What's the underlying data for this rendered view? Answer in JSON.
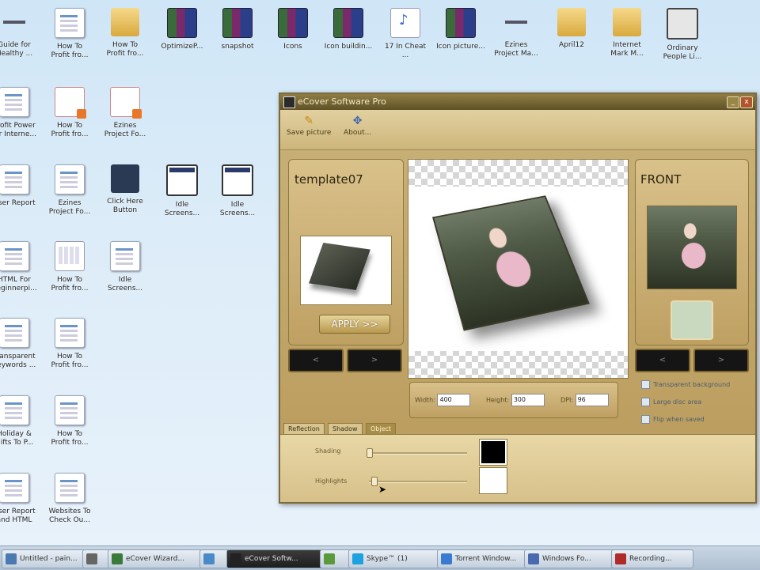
{
  "desktop": {
    "icons": [
      {
        "label": "Guide for\nHealthy ...",
        "glyph": "link-icon"
      },
      {
        "label": "How To\nProfit fro...",
        "glyph": "document-icon"
      },
      {
        "label": "How To\nProfit fro...",
        "glyph": "folder-icon"
      },
      {
        "label": "OptimizeP...",
        "glyph": "archive-icon"
      },
      {
        "label": "snapshot",
        "glyph": "archive-icon"
      },
      {
        "label": "Icons",
        "glyph": "archive-icon"
      },
      {
        "label": "Icon buildin...",
        "glyph": "archive-icon"
      },
      {
        "label": "17 In Cheat\n...",
        "glyph": "audio-file-icon"
      },
      {
        "label": "Icon picture...",
        "glyph": "archive-icon"
      },
      {
        "label": "Ezines\nProject Ma...",
        "glyph": "link-icon"
      },
      {
        "label": "April12",
        "glyph": "folder-icon"
      },
      {
        "label": "Internet\nMark M...",
        "glyph": "folder-icon"
      },
      {
        "label": "Ordinary\nPeople Li...",
        "glyph": "window-icon"
      },
      {
        "label": "Profit Power\nfor Interne...",
        "glyph": "document-icon"
      },
      {
        "label": "How To\nProfit fro...",
        "glyph": "pdf-icon"
      },
      {
        "label": "Ezines\nProject Fo...",
        "glyph": "pdf-icon"
      },
      {
        "label": "User Report",
        "glyph": "document-icon"
      },
      {
        "label": "Ezines\nProject Fo...",
        "glyph": "document-icon"
      },
      {
        "label": "Click Here\nButton",
        "glyph": "button-image-icon"
      },
      {
        "label": "Idle\nScreens...",
        "glyph": "screenshot-icon"
      },
      {
        "label": "Idle\nScreens...",
        "glyph": "screenshot-icon"
      },
      {
        "label": "HTML For\nBeginnerpi...",
        "glyph": "document-icon"
      },
      {
        "label": "How To\nProfit fro...",
        "glyph": "calendar-icon"
      },
      {
        "label": "Idle\nScreens...",
        "glyph": "document-icon"
      },
      {
        "label": "Transparent\nKeywords ...",
        "glyph": "document-icon"
      },
      {
        "label": "How To\nProfit fro...",
        "glyph": "document-icon"
      },
      {
        "label": "Holiday &\nGifts To P...",
        "glyph": "document-icon"
      },
      {
        "label": "How To\nProfit fro...",
        "glyph": "document-icon"
      },
      {
        "label": "User Report\nand HTML",
        "glyph": "document-icon"
      },
      {
        "label": "Websites To\nCheck Ou...",
        "glyph": "document-icon"
      }
    ]
  },
  "window": {
    "title": "eCover Software Pro",
    "buttons": {
      "minimize": "_",
      "close": "x"
    },
    "toolbar": {
      "save_label": "Save picture",
      "about_label": "About..."
    },
    "template_panel": {
      "title": "template07",
      "apply_label": "APPLY >>"
    },
    "front_panel": {
      "title": "FRONT"
    },
    "nav_prev": "<",
    "nav_next": ">",
    "fields": {
      "width_label": "Width:",
      "width_value": "400",
      "height_label": "Height:",
      "height_value": "300",
      "dpi_label": "DPI:",
      "dpi_value": "96"
    },
    "options": {
      "transparent": "Transparent background",
      "large_disc": "Large disc area",
      "flip": "Flip when saved"
    },
    "tabs": [
      "Reflection",
      "Shadow",
      "Object"
    ],
    "active_tab": "Object",
    "sliders": {
      "shading_label": "Shading",
      "shading_value": 0.0,
      "highlights_label": "Highlights",
      "highlights_value": 0.05,
      "shading_color": "#000000",
      "highlights_color": "#ffffff"
    }
  },
  "taskbar": {
    "items": [
      {
        "label": "Untitled - pain..."
      },
      {
        "label": ""
      },
      {
        "label": "eCover Wizard..."
      },
      {
        "label": ""
      },
      {
        "label": "eCover Softw..."
      },
      {
        "label": ""
      },
      {
        "label": "Skype™ (1)"
      },
      {
        "label": "Torrent Window..."
      },
      {
        "label": "Windows Fo..."
      },
      {
        "label": "Recording..."
      }
    ]
  }
}
